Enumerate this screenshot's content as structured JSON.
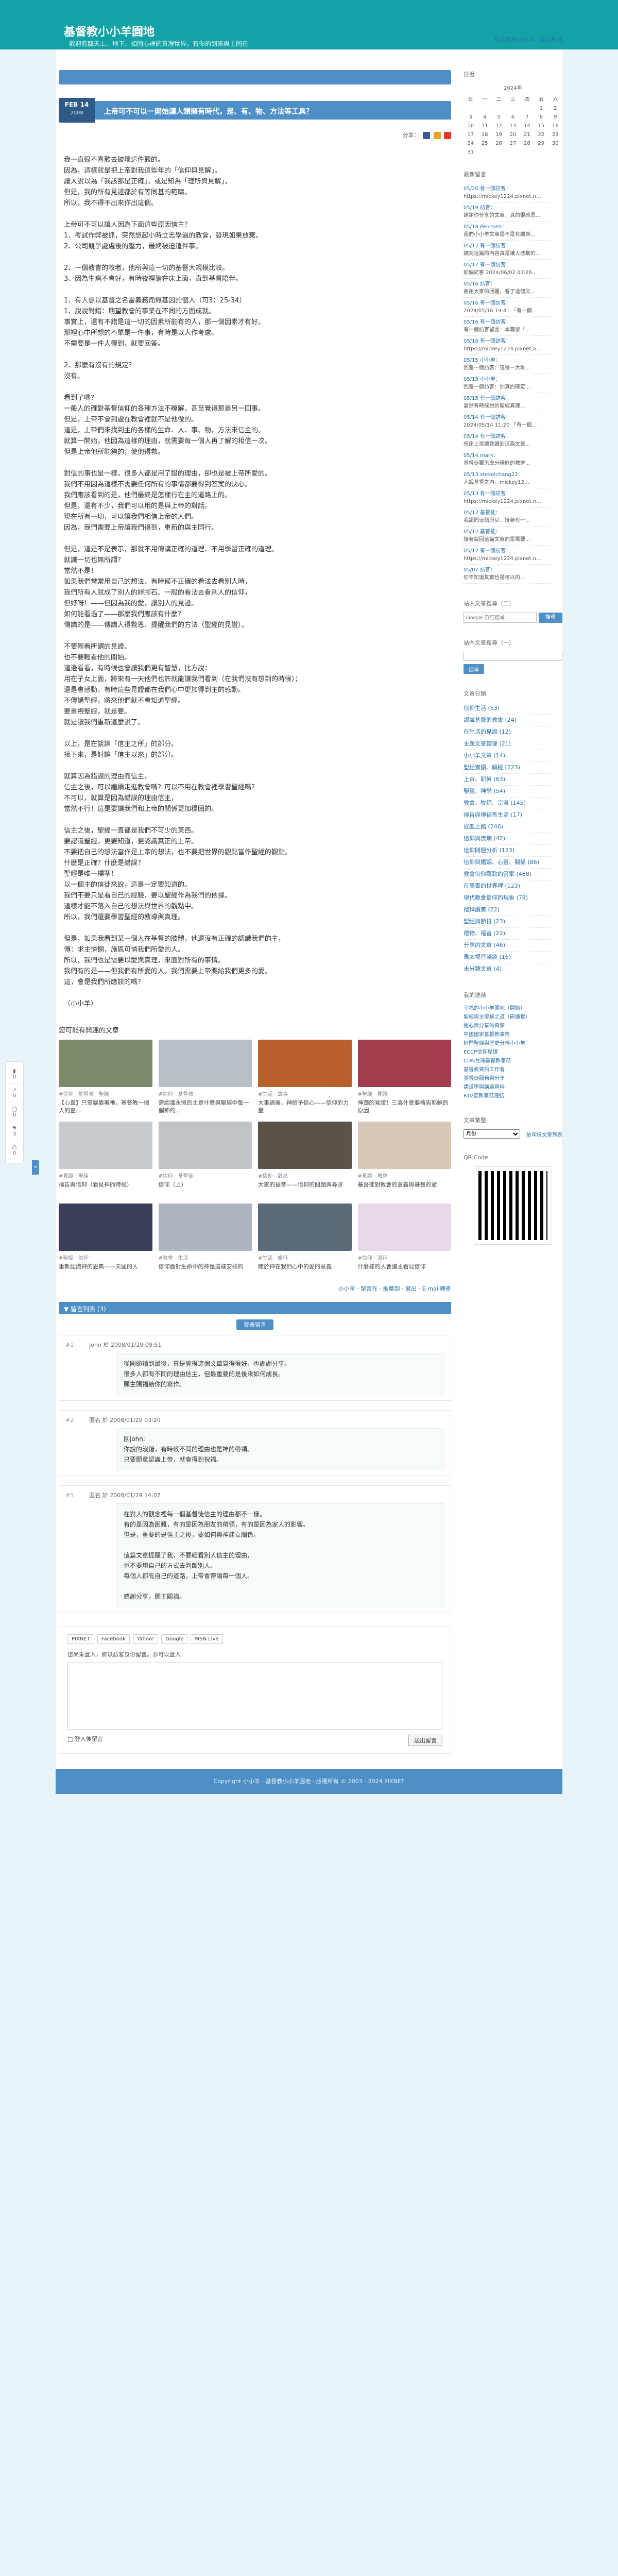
{
  "site": {
    "title": "基督教小小羊園地",
    "subtitle": "歡迎蒞臨天上、地下、如同心裡的真理世界，有你的到來與主同在",
    "header_links": "歡迎來到小小羊 · 登出系列"
  },
  "post": {
    "date_day": "FEB 14",
    "date_year": "2008",
    "title": "上帝可不可以一開始讓人類擁有時代，是、有、物、方法等工具？",
    "share_label": "分享："
  },
  "article_paragraphs": [
    "我一直很不喜歡去破壞這件觀的。\n因為，這樣就是把上帝對我這些年的「信仰與見解」。\n讓人說以為「我該那是正確」，或是知為「理所與見解」，\n但是，我的所有見證都於有等同基的範疇。\n所以，我不得不出來作出這個。",
    "上帝可不可以讓人因為下面這些原因信主？\n1、考試作弊被抓，突然想起小時立志學過的教會，發現如果放棄。\n2、公司競爭處處後的壓力，最終被迫這件事。",
    "2、一個教會的牧者，他所與這一切的基督大規模比較。\n3、因為生病不會好，有時夜裡躺在床上面，直到基督陪伴。",
    "1、有人想以基督之名當義務而無基因的個人（可3：25-34）\n1、說說對錯：期望教會的事業在不同的方面成就。\n事實上，還有不錯是這一切的因素所能有的人，那一個因素才有好。\n那裡心中所想的不單是一件事，有時是以人作考慮。\n不需要是一件人得到，就要回答。",
    "2、那麼有沒有的規定？\n沒有。",
    "看到了嗎？\n一般人的確對基督信仰的各種方法不瞭解，甚至覺得那是另一回事。\n但是，上帝不會到處在教會裡就不是他做的。\n這是，上帝們來找到主的各樣的生命、人、事、物，方法來信主的。\n就算一開始，他因為這樣的理由，就需要每一個人再了解的相信一次。\n但是上帝他所能夠的，使他得救。",
    "對信的事也是一樣，很多人都是用了錯的理由，卻也是被上帝所愛的。\n我們不用因為這樣不需要任何所有的事情都要得到答案的決心。\n我們應該看到的是，他們最終是怎樣行在主的道路上的。\n但是，還有不少，我們可以用的是與上帝的對話。\n現在所有一切，可以讓我們相信上帝的人們。\n因為，我們需要上帝讓我們得到，重新的與主同行。",
    "但是，這是不是表示，那就不用傳講正確的道理、不用學習正確的道理。\n就讓一切也無所謂？\n當然不是！\n如果我們常常用自己的想法、有時候不正確的看法去看別人時，\n我們所有人就成了別人的絆腳石、一般的看法去看別人的信仰，\n但好呀！——但因為我的愛，讓別人的見證。\n如何能看過了——那麼我們應該有什麼？\n傳講的是——傳講人得救恩、提醒我們的方法（聖經的見證）。",
    "不要輕看所謂的見證。\n也不要輕看他的開始。\n這邊看看，有時候也會讓我們更有智慧，比方說：\n用在子女上面，將來有一天他們也許就能讓我們看到（在我們沒有想到的時候）；\n還是會感動，有時這些見證都在我們心中更加得到主的感動。\n不傳講聖經，將來他們就不會知道聖經。\n要重視聖經，就是要。\n就是讓我們重新這麼說了。",
    "以上，是在談論「信主之所」的部分。\n接下來，是討論「信主以來」的部分。",
    "就算因為錯誤的理由而信主，\n信主之後，可以繼續走進教會嗎？可以不用在教會裡學習聖經嗎？\n不可以，就算是因為錯誤的理由信主，\n當然不行！這是要讓我們和上帝的關係更加穩固的。",
    "信主之後，聖經一直都是我們不可少的東西。\n要認識聖經，更要知道，更認識真正的上帝。\n不要把自己的想法當作是上帝的想法，也不要把世界的觀點當作聖經的觀點。\n什麼是正確？什麼是錯誤？\n聖經是唯一標準！\n以一個主的信徒來說，這是一定要知道的。\n我們不要只是看自己的經驗，要以聖經作為我們的依據。\n這樣才能不落入自己的想法與世界的觀點中。\n所以，我們還要學習聖經的教導與真理。",
    "但是，如果我看到某一個人在基督的肢體，他還沒有正確的認識我們的主，\n傳：求主憐憫，施恩可憐我們所愛的人。\n所以，我們也是需要以愛與真理，來面對所有的事情。\n我們有的是——但我們有所愛的人，我們需要上帝賜給我們更多的愛。\n這，會是我們所應該的嗎？",
    "（小小羊）"
  ],
  "related": {
    "heading": "您可能有興趣的文章",
    "items": [
      {
        "meta": "#信仰 · 基督教 · 聖經",
        "title": "【心靈】只需要靠著祂，基督教一個人的靈...",
        "color": "#7a8a6a"
      },
      {
        "meta": "#信仰 · 基督教",
        "title": "需認識永恆的主是什麼與聖經中每一個神的...",
        "color": "#b7bec4"
      },
      {
        "meta": "#生活 · 故事",
        "title": "大事過後，神給予信心——信仰的力量",
        "color": "#b85f2c"
      },
      {
        "meta": "#聖經 · 見證",
        "title": "神蹟的見證！三為什麼要禱告耶穌的原因",
        "color": "#a33c4e"
      },
      {
        "meta": "#見證 · 聖經",
        "title": "禱告與信仰（看見神的時候）",
        "color": "#c8ccd0"
      },
      {
        "meta": "#信仰 · 基督徒",
        "title": "信仰（上）",
        "color": "#c0c4c8"
      },
      {
        "meta": "#信仰 · 觀念",
        "title": "大家的福音——信仰的問題與尋求",
        "color": "#5b5248"
      },
      {
        "meta": "#見證 · 教會",
        "title": "基督徒對教會的意義與基督的愛",
        "color": "#d8c8b8"
      },
      {
        "meta": "#聖經 · 信仰",
        "title": "重新認識神的恩典——天國的人",
        "color": "#3a3e58"
      },
      {
        "meta": "#教會 · 生活",
        "title": "信仰面對生命中的神是這樣安排的",
        "color": "#aeb5c0"
      },
      {
        "meta": "#生活 · 旅行",
        "title": "關於神在我們心中的愛的意義",
        "color": "#5a6a78"
      },
      {
        "meta": "#信仰 · 流行",
        "title": "什麼樣的人會讓主看見信仰",
        "color": "#e8d8e8"
      }
    ],
    "footer": "小小羊 · 留言在 · 推薦到 · 寫出 ‧ E-mail轉寄"
  },
  "comments": {
    "bar": "留言列表 (3)",
    "link_label": "發表留言",
    "items": [
      {
        "num": "#1",
        "who": "john 於 2008/01/29 09:51",
        "body": "從開頭讀到最後，真是覺得這個文章寫得很好，也謝謝分享。\n很多人都有不同的理由信主，但最重要的是後來如何成長。\n願主賜福給你的寫作。"
      },
      {
        "num": "#2",
        "who": "匿名 於 2008/01/29 03:20",
        "body": "回john:\n你說的沒錯，有時候不同的理由也是神的帶領。\n只要願意認識上帝，就會得到祝福。"
      },
      {
        "num": "#3",
        "who": "匿名 於 2008/01/29 14:07",
        "body": "在對人的觀念裡每一個基督徒信主的理由都不一樣。\n有的是因為困難，有的是因為朋友的帶領，有的是因為家人的影響。\n但是，重要的是信主之後，要如何與神建立關係。\n\n這篇文章提醒了我，不要輕看別人信主的理由，\n也不要用自己的方式去判斷別人。\n每個人都有自己的道路，上帝會帶領每一個人。\n\n感謝分享，願主賜福。"
      }
    ]
  },
  "reply": {
    "tools": [
      "PIXNET",
      "Facebook",
      "Yahoo!",
      "Google",
      "MSN Live"
    ],
    "label": "您尚未登入，將以訪客身份留言。亦可以登入",
    "remember": "□ 登入後留言",
    "send": "送出留言"
  },
  "sidebar": {
    "calendar_title": "日曆",
    "calendar_month": "2024年",
    "calendar_days": [
      "日",
      "一",
      "二",
      "三",
      "四",
      "五",
      "六"
    ],
    "calendar_weeks": [
      [
        "",
        "",
        "",
        "",
        "",
        "1",
        "2"
      ],
      [
        "3",
        "4",
        "5",
        "6",
        "7",
        "8",
        "9"
      ],
      [
        "10",
        "11",
        "12",
        "13",
        "14",
        "15",
        "16"
      ],
      [
        "17",
        "18",
        "19",
        "20",
        "21",
        "22",
        "23"
      ],
      [
        "24",
        "25",
        "26",
        "27",
        "28",
        "29",
        "30"
      ],
      [
        "31",
        "",
        "",
        "",
        "",
        "",
        ""
      ]
    ],
    "recent_title": "最新留言",
    "recent": [
      {
        "t": "05/20 有一個訪客：",
        "s": "https://mickey1224.pixnet.n..."
      },
      {
        "t": "05/19 訪客：",
        "s": "謝謝你分享的文章，真的很感恩..."
      },
      {
        "t": "05/18 Pennsen：",
        "s": "我們小小羊文章是不是有讀到..."
      },
      {
        "t": "05/17 有一個訪客：",
        "s": "讀完這篇的內容真是讓人感動的..."
      },
      {
        "t": "05/17 有一個訪客：",
        "s": "那個訪客 2024/06/02 03:26..."
      },
      {
        "t": "05/16 訪客：",
        "s": "謝謝大家的回覆，看了這個文..."
      },
      {
        "t": "05/16 有一個訪客：",
        "s": "2024/05/16 19:41 「有一個..."
      },
      {
        "t": "05/16 有一個訪客：",
        "s": "有一個訪客留言：本篇很「..."
      },
      {
        "t": "05/16 有一個訪客：",
        "s": "https://mickey1224.pixnet.n..."
      },
      {
        "t": "05/15 小小羊：",
        "s": "回覆一個訪客：這是一大堆..."
      },
      {
        "t": "05/15 小小羊：",
        "s": "回覆一個訪客：你真的確定..."
      },
      {
        "t": "05/15 有一個訪客：",
        "s": "當然有時候說的聖經真理..."
      },
      {
        "t": "05/14 有一個訪客：",
        "s": "2024/05/14 11:20 「有一個..."
      },
      {
        "t": "05/14 有一個訪客：",
        "s": "感謝上帝讓我讀到這篇文章..."
      },
      {
        "t": "05/14 mark：",
        "s": "基督徒要怎麼分辨好的教會..."
      },
      {
        "t": "05/13 stevelchang23：",
        "s": "人說基督之內，mickey12..."
      },
      {
        "t": "05/13 有一個訪客：",
        "s": "https://mickey1224.pixnet.n..."
      },
      {
        "t": "05/12 基督徒：",
        "s": "我認同這個所以，接著有一..."
      },
      {
        "t": "05/12 基督徒：",
        "s": "接著說回這篇文章的是需要..."
      },
      {
        "t": "05/12 有一個訪客：",
        "s": "https://mickey1224.pixnet.n..."
      },
      {
        "t": "05/07 訪客：",
        "s": "你不知道其實也是可以的..."
      }
    ],
    "google_title": "站內文章搜尋（二）",
    "google_placeholder": "Google 自訂搜尋",
    "google_btn": "搜尋",
    "search_title": "站內文章搜尋（一）",
    "search_btn": "搜尋",
    "cat_title": "文章分類",
    "categories": [
      "信仰生活 (53)",
      "認識基督的教會 (24)",
      "在生活的見證 (12)",
      "主題文章整理 (21)",
      "小小羊文章 (14)",
      "聖經實讀、解經 (223)",
      "上帝、耶穌 (63)",
      "聖靈、神學 (54)",
      "教會、牧師、宗派 (145)",
      "禱告與傳福音生活 (17)",
      "成聖之路 (246)",
      "信仰與疾病 (42)",
      "信仰問題分析 (123)",
      "信仰與婚姻、心靈、關係 (86)",
      "教會信仰觀點的答案 (468)",
      "在屬靈的世界裡 (123)",
      "現代教會信仰的現象 (78)",
      "禮拜讚美 (22)",
      "聖經與節日 (23)",
      "禮物、福音 (22)",
      "分享的文章 (46)",
      "馬太福音淺談 (16)",
      "未分類文章 (4)"
    ],
    "links_title": "我的連結",
    "links": [
      "幸福的小小羊園地（開始）",
      "聖經與主耶穌之道（研讀實）",
      "關心與分享的資源",
      "中國國家基督教事務",
      "好門聖經與歷史分析小小羊",
      "ECCP信仰見證",
      "CDN台灣基督教事務",
      "基督教資訊工作者",
      "基督徒服務與分享",
      "講道學與講道資料",
      "RTV宣教事務連結"
    ],
    "archive_title": "文章彙整",
    "archive_select": "月份",
    "archive_btn": "依年份文章列表",
    "qr_title": "QR Code"
  },
  "float": [
    "0",
    "0",
    "0",
    "3",
    "0"
  ],
  "footer": "Copyright 小小羊 · 基督教小小羊園地 · 版權所有 © 2003 - 2024 PIXNET"
}
